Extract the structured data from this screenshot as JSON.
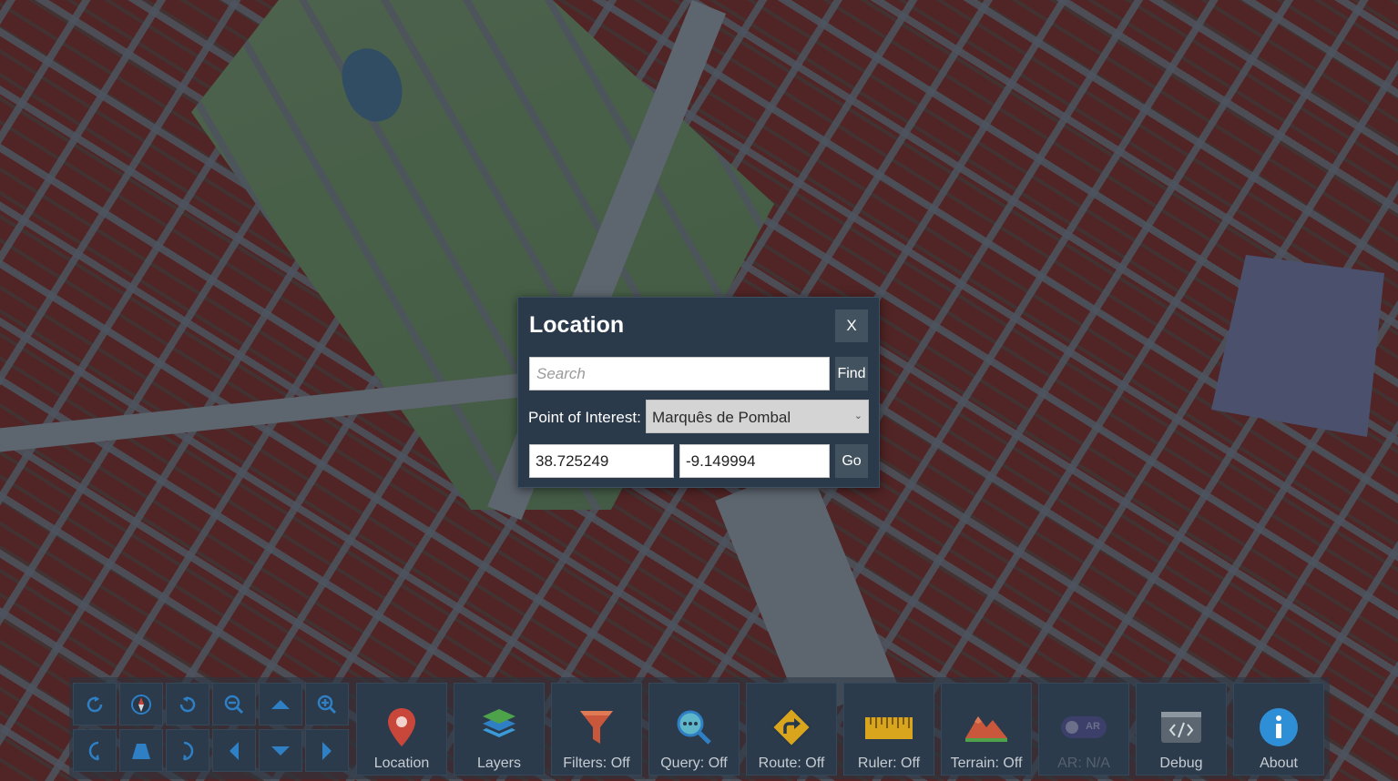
{
  "dialog": {
    "title": "Location",
    "close_label": "X",
    "search_placeholder": "Search",
    "search_value": "",
    "find_label": "Find",
    "poi_label": "Point of Interest:",
    "poi_selected": "Marquês de Pombal",
    "latitude": "38.725249",
    "longitude": "-9.149994",
    "go_label": "Go"
  },
  "nav_controls": [
    {
      "name": "rotate-left-icon"
    },
    {
      "name": "compass-icon"
    },
    {
      "name": "rotate-right-icon"
    },
    {
      "name": "zoom-out-icon"
    },
    {
      "name": "pan-up-icon"
    },
    {
      "name": "zoom-in-icon"
    },
    {
      "name": "tilt-left-icon"
    },
    {
      "name": "tilt-icon"
    },
    {
      "name": "tilt-right-icon"
    },
    {
      "name": "pan-left-icon"
    },
    {
      "name": "pan-down-icon"
    },
    {
      "name": "pan-right-icon"
    }
  ],
  "toolbar": {
    "location": {
      "label": "Location",
      "icon": "map-pin-icon"
    },
    "layers": {
      "label": "Layers",
      "icon": "layers-icon"
    },
    "filters": {
      "label": "Filters: Off",
      "icon": "filter-icon"
    },
    "query": {
      "label": "Query: Off",
      "icon": "query-magnifier-icon"
    },
    "route": {
      "label": "Route: Off",
      "icon": "route-sign-icon"
    },
    "ruler": {
      "label": "Ruler: Off",
      "icon": "ruler-icon"
    },
    "terrain": {
      "label": "Terrain: Off",
      "icon": "terrain-icon"
    },
    "ar": {
      "label": "AR: N/A",
      "icon": "ar-toggle-icon",
      "badge": "AR"
    },
    "debug": {
      "label": "Debug",
      "icon": "code-icon"
    },
    "about": {
      "label": "About",
      "icon": "info-icon"
    }
  },
  "colors": {
    "buildings": "#7a241e",
    "roads": "#8b939e",
    "park": "#6f8d63",
    "panel": "#2a3a4b",
    "button": "#42525f",
    "pin": "#c9463a",
    "info": "#2f8fd6"
  }
}
